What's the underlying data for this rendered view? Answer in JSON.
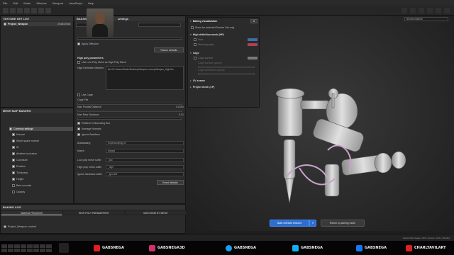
{
  "menu": [
    "File",
    "Edit",
    "Mode",
    "Window",
    "Viewport",
    "JavaScript",
    "Help"
  ],
  "texture_set_list": {
    "title": "TEXTURE SET LIST",
    "item": "Project_Weapon",
    "size": "2048x2048"
  },
  "bake_panel": {
    "header": "BAKING",
    "title": "settings",
    "apply_diffusion": "Apply Diffusion",
    "texture_defaults": "Texture defaults",
    "high_poly_params": "High poly parameters",
    "use_low_poly": "Use Low Poly Mesh as High Poly Mesh",
    "hd_meshes_label": "High Definition Meshes",
    "hd_meshes_value": "file:///C:/Users/Studio/Desktop/Weapon-convey/Weapon_High.fbx",
    "use_cage": "Use Cage",
    "cage_file": "Cage File",
    "max_frontal": "Max Frontal Distance",
    "max_frontal_val": "0.0100",
    "max_rear": "Max Rear Distance",
    "max_rear_val": "0.01",
    "relative_bbox": "Relative to Bounding Box",
    "average_normals": "Average Normals",
    "ignore_backface": "Ignore Backface",
    "antialiasing": "Antialiasing",
    "antialiasing_val": "Supersampling 4x",
    "match": "Match",
    "match_val": "Always",
    "low_suffix": "Low poly mesh suffix",
    "low_suffix_val": "_low",
    "high_suffix": "High poly mesh suffix",
    "high_suffix_val": "_high",
    "ignore_suffix": "Ignore backface suffix",
    "ignore_suffix_val": "_ignorebf",
    "reset_defaults": "Reset defaults"
  },
  "mesh_map_bakers": {
    "title": "MESH MAP BAKERS",
    "items": [
      "Common settings",
      "Normal",
      "World space normal",
      "ID",
      "Ambient occlusion",
      "Curvature",
      "Position",
      "Thickness",
      "Height",
      "Bent normals",
      "Opacity"
    ]
  },
  "baking_log": {
    "title": "BAKING LOG",
    "tabs": [
      "BAKING PROCESS",
      "HIGH POLY PARAMETERS",
      "MATCHING BY MESH"
    ],
    "entry": "Project_Weapon: cooked"
  },
  "baking_visualization": {
    "title": "Baking visualization",
    "show_selected": "Show for selected Texture Set only",
    "hd_mesh": "High definition mesh (HP)",
    "hd_rows": [
      "Hide",
      "Matching style"
    ],
    "cage": "Cage",
    "cage_rows": [
      "Cage surface",
      "Cage surface opacity",
      "Cage wireframe opacity"
    ],
    "uv_seams": "UV seams",
    "project_mesh": "Project mesh (LP)",
    "colors": {
      "hd": "#3b6ea8",
      "match": "#b04050",
      "cage": "#7a7a7a"
    }
  },
  "viewport": {
    "material_dropdown": "Neutral material"
  },
  "bake_button": "Bake selected textures",
  "return_button": "Return to painting mode",
  "status_text": "Cache Disk Usage:  43%  |  Version: 10.0.1 (Studio)",
  "socials": [
    {
      "icon": "youtube-icon",
      "name": "GABSNEGA",
      "color": "#e02020"
    },
    {
      "icon": "instagram-icon",
      "name": "GABSNEGA3D",
      "color": "#d1306c"
    },
    {
      "icon": "twitter-icon",
      "name": "GABSNEGA",
      "color": "#1d9bf0"
    },
    {
      "icon": "artstation-icon",
      "name": "GABSNEGA",
      "color": "#13aff0"
    },
    {
      "icon": "facebook-icon",
      "name": "GABSNEGA",
      "color": "#1877f2"
    },
    {
      "icon": "youtube-icon",
      "name": "CHARLYAVILART",
      "color": "#e02020"
    }
  ]
}
